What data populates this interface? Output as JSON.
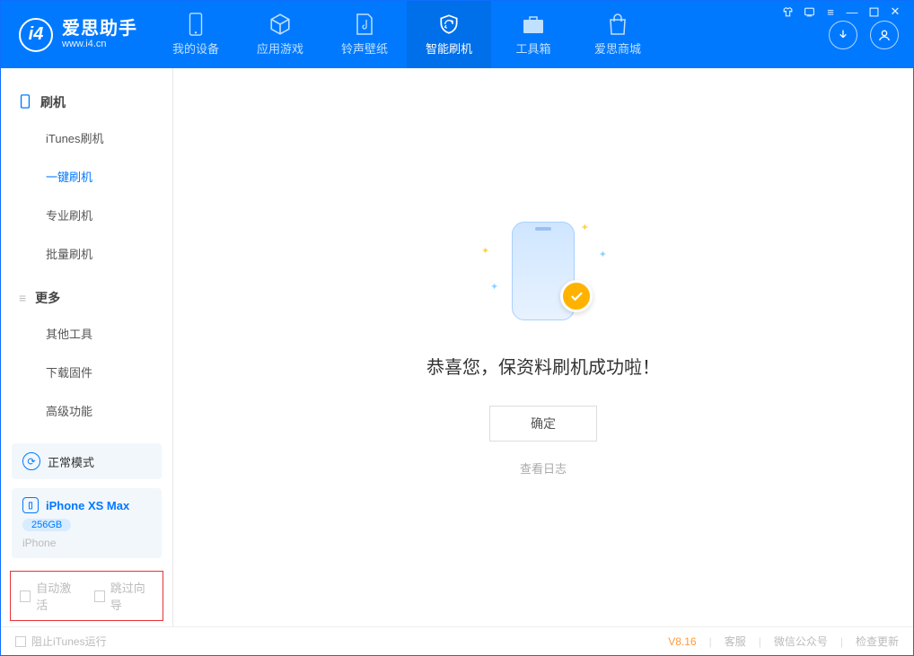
{
  "app": {
    "logo_title": "爱思助手",
    "logo_sub": "www.i4.cn"
  },
  "nav": {
    "items": [
      {
        "label": "我的设备"
      },
      {
        "label": "应用游戏"
      },
      {
        "label": "铃声壁纸"
      },
      {
        "label": "智能刷机"
      },
      {
        "label": "工具箱"
      },
      {
        "label": "爱思商城"
      }
    ],
    "active_index": 3
  },
  "sidebar": {
    "section1_title": "刷机",
    "section1_items": [
      {
        "label": "iTunes刷机"
      },
      {
        "label": "一键刷机"
      },
      {
        "label": "专业刷机"
      },
      {
        "label": "批量刷机"
      }
    ],
    "section1_active_index": 1,
    "section2_title": "更多",
    "section2_items": [
      {
        "label": "其他工具"
      },
      {
        "label": "下载固件"
      },
      {
        "label": "高级功能"
      }
    ]
  },
  "mode": {
    "label": "正常模式"
  },
  "device": {
    "name": "iPhone XS Max",
    "storage": "256GB",
    "subline": "iPhone"
  },
  "options": {
    "auto_activate": "自动激活",
    "skip_guide": "跳过向导"
  },
  "content": {
    "success_msg": "恭喜您，保资料刷机成功啦！",
    "confirm": "确定",
    "view_log": "查看日志"
  },
  "footer": {
    "block_itunes": "阻止iTunes运行",
    "version": "V8.16",
    "link_service": "客服",
    "link_wechat": "微信公众号",
    "link_update": "检查更新"
  }
}
